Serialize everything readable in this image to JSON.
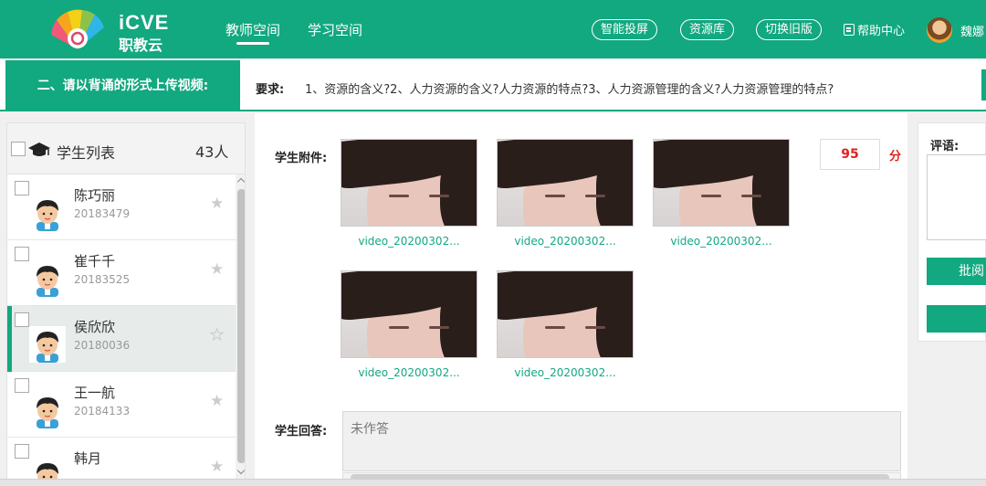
{
  "brand": {
    "name_en": "iCVE",
    "name_cn": "职教云"
  },
  "nav": [
    {
      "label": "教师空间",
      "active": true
    },
    {
      "label": "学习空间",
      "active": false
    }
  ],
  "header_buttons": [
    "智能投屏",
    "资源库",
    "切换旧版"
  ],
  "help": "帮助中心",
  "user": {
    "name": "魏娜"
  },
  "requirement": {
    "title": "二、请以背诵的形式上传视频:",
    "label": "要求:",
    "text": "1、资源的含义?2、人力资源的含义?人力资源的特点?3、人力资源管理的含义?人力资源管理的特点?"
  },
  "student_list": {
    "title": "学生列表",
    "count": "43人",
    "students": [
      {
        "name": "陈巧丽",
        "id": "20183479",
        "active": false
      },
      {
        "name": "崔千千",
        "id": "20183525",
        "active": false
      },
      {
        "name": "侯欣欣",
        "id": "20180036",
        "active": true
      },
      {
        "name": "王一航",
        "id": "20184133",
        "active": false
      },
      {
        "name": "韩月",
        "id": "",
        "active": false
      }
    ]
  },
  "main": {
    "attachments_label": "学生附件:",
    "attachments": [
      "video_20200302...",
      "video_20200302...",
      "video_20200302...",
      "video_20200302...",
      "video_20200302..."
    ],
    "score": "95",
    "score_unit": "分",
    "answer_label": "学生回答:",
    "answer_text": "未作答"
  },
  "comment": {
    "label": "评语:",
    "review_button": "批阅"
  },
  "colors": {
    "primary": "#12a880",
    "score": "#e02020"
  }
}
